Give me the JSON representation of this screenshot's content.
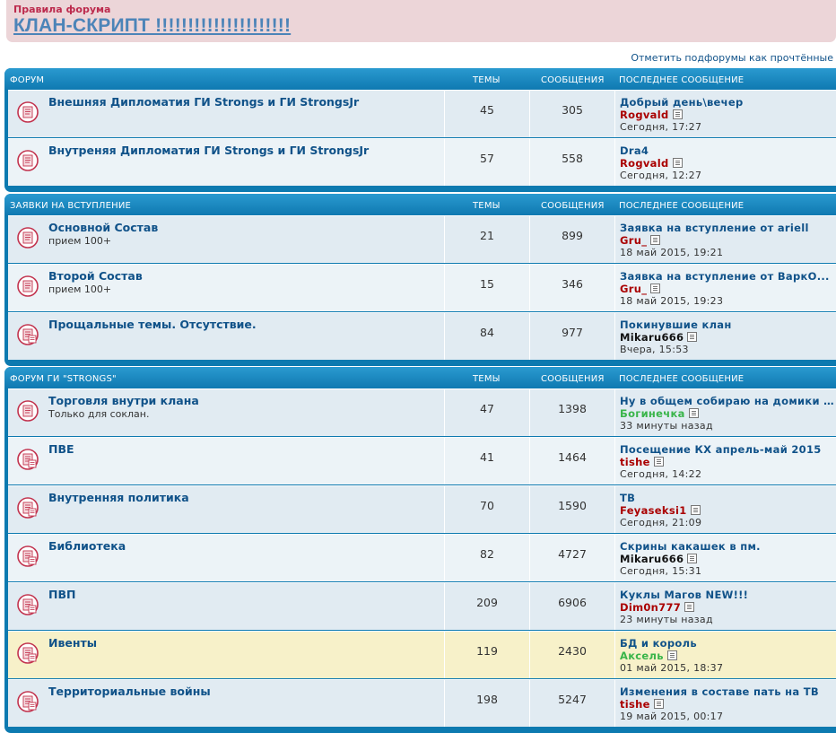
{
  "rules": {
    "small": "Правила форума",
    "big": "КЛАН-СКРИПТ !!!!!!!!!!!!!!!!!!!!!"
  },
  "mark_read": "Отметить подфорумы как прочтённые",
  "columns": {
    "topics": "Темы",
    "posts": "Сообщения",
    "last": "Последнее сообщение"
  },
  "colors": {
    "header_blue": "#0d7ab0",
    "row_bg": "#e1ebf2",
    "highlight_bg": "#f7f1c9",
    "author_red": "#aa0000",
    "author_green": "#3ab54a",
    "author_black": "#111111"
  },
  "blocks": [
    {
      "title": "Форум",
      "rows": [
        {
          "title": "Внешняя Дипломатия ГИ Strongs и ГИ StrongsJr",
          "desc": "",
          "topics": "45",
          "posts": "305",
          "last_title": "Добрый день\\вечер",
          "last_author": "Rogvald",
          "author_color": "#aa0000",
          "last_time": "Сегодня, 17:27",
          "icon": "forum-read-icon"
        },
        {
          "title": "Внутреняя Дипломатия ГИ Strongs и ГИ StrongsJr",
          "desc": "",
          "topics": "57",
          "posts": "558",
          "last_title": "Dra4",
          "last_author": "Rogvald",
          "author_color": "#aa0000",
          "last_time": "Сегодня, 12:27",
          "icon": "forum-read-icon"
        }
      ]
    },
    {
      "title": "Заявки на вступление",
      "rows": [
        {
          "title": "Основной Состав",
          "desc": "прием 100+",
          "topics": "21",
          "posts": "899",
          "last_title": "Заявка на вступление от ariell",
          "last_author": "Gru_",
          "author_color": "#aa0000",
          "last_time": "18 май 2015, 19:21",
          "icon": "forum-read-icon"
        },
        {
          "title": "Второй Состав",
          "desc": "прием 100+",
          "topics": "15",
          "posts": "346",
          "last_title": "Заявка на вступление от ВаркО...",
          "last_author": "Gru_",
          "author_color": "#aa0000",
          "last_time": "18 май 2015, 19:23",
          "icon": "forum-read-icon"
        },
        {
          "title": "Прощальные темы. Отсутствие.",
          "desc": "",
          "topics": "84",
          "posts": "977",
          "last_title": "Покинувшие клан",
          "last_author": "Mikaru666",
          "author_color": "#111111",
          "last_time": "Вчера, 15:53",
          "icon": "forum-locked-icon"
        }
      ]
    },
    {
      "title": "Форум ГИ \"Strongs\"",
      "rows": [
        {
          "title": "Торговля внутри клана",
          "desc": "Только для соклан.",
          "topics": "47",
          "posts": "1398",
          "last_title": "Ну в общем собираю на домики ...",
          "last_author": "Богинечка",
          "author_color": "#3ab54a",
          "last_time": "33 минуты назад",
          "icon": "forum-read-icon"
        },
        {
          "title": "ПВЕ",
          "desc": "",
          "topics": "41",
          "posts": "1464",
          "last_title": "Посещение КХ апрель-май 2015",
          "last_author": "tishe",
          "author_color": "#aa0000",
          "last_time": "Сегодня, 14:22",
          "icon": "forum-locked-icon"
        },
        {
          "title": "Внутренняя политика",
          "desc": "",
          "topics": "70",
          "posts": "1590",
          "last_title": "ТВ",
          "last_author": "Feyaseksi1",
          "author_color": "#aa0000",
          "last_time": "Сегодня, 21:09",
          "icon": "forum-locked-icon"
        },
        {
          "title": "Библиотека",
          "desc": "",
          "topics": "82",
          "posts": "4727",
          "last_title": "Скрины какашек в пм.",
          "last_author": "Mikaru666",
          "author_color": "#111111",
          "last_time": "Сегодня, 15:31",
          "icon": "forum-locked-icon"
        },
        {
          "title": "ПВП",
          "desc": "",
          "topics": "209",
          "posts": "6906",
          "last_title": "Куклы Магов NEW!!!",
          "last_author": "Dim0n777",
          "author_color": "#aa0000",
          "last_time": "23 минуты назад",
          "icon": "forum-locked-icon"
        },
        {
          "title": "Ивенты",
          "desc": "",
          "topics": "119",
          "posts": "2430",
          "last_title": "БД и король",
          "last_author": "Аксель",
          "author_color": "#3ab54a",
          "last_time": "01 май 2015, 18:37",
          "icon": "forum-locked-icon",
          "highlight": true
        },
        {
          "title": "Территориальные войны",
          "desc": "",
          "topics": "198",
          "posts": "5247",
          "last_title": "Изменения в составе пать на ТВ",
          "last_author": "tishe",
          "author_color": "#aa0000",
          "last_time": "19 май 2015, 00:17",
          "icon": "forum-locked-icon"
        }
      ]
    }
  ]
}
